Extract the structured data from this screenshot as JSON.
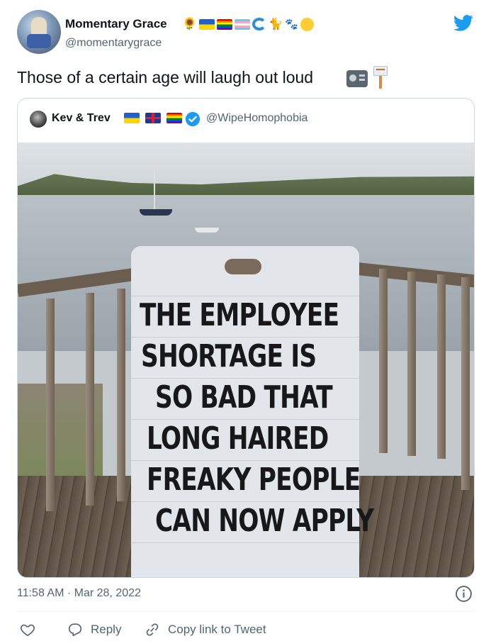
{
  "author": {
    "name": "Momentary Grace",
    "handle": "@momentarygrace",
    "name_emojis": [
      "🌻",
      "🇺🇦",
      "🏳️‍🌈",
      "🏳️‍⚧️",
      "🌊",
      "🐈‍⬛",
      "🐾",
      "🙃"
    ]
  },
  "tweet": {
    "text": "Those of a certain age will laugh out loud",
    "emojis": [
      "📻",
      "🪧"
    ]
  },
  "quoted": {
    "name": "Kev & Trev",
    "handle": "@WipeHomophobia",
    "flags": [
      "🇺🇦",
      "🇬🇧",
      "🏳️‍🌈"
    ],
    "verified": true,
    "image": {
      "sign_lines": [
        "THE EMPLOYEE",
        "SHORTAGE IS",
        "SO BAD THAT",
        "LONG HAIRED",
        "FREAKY PEOPLE",
        "CAN NOW APPLY"
      ]
    }
  },
  "meta": {
    "timestamp": "11:58 AM · Mar 28, 2022"
  },
  "actions": {
    "like_label": "",
    "reply_label": "Reply",
    "copy_label": "Copy link to Tweet"
  },
  "colors": {
    "brand": "#1d9bf0",
    "text_primary": "#0f1419",
    "text_secondary": "#536471",
    "border": "#cfd9de"
  }
}
